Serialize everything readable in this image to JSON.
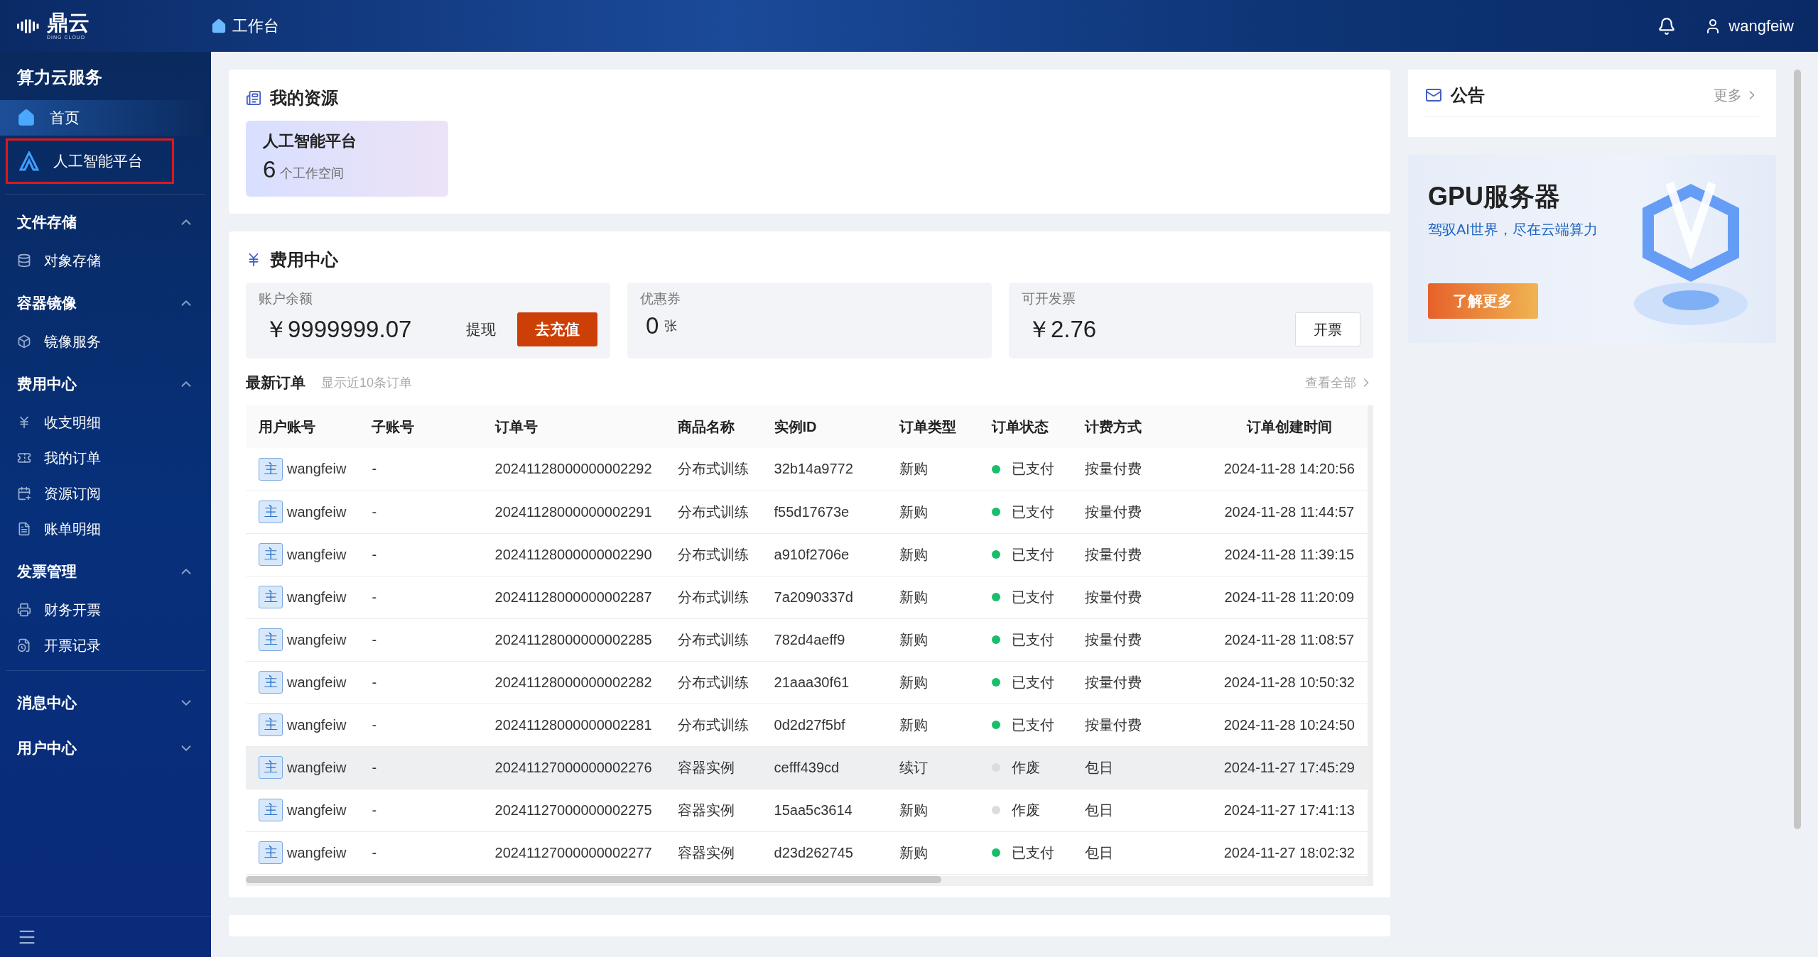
{
  "header": {
    "logo_text": "鼎云",
    "logo_subtext": "DING CLOUD",
    "breadcrumb": "工作台",
    "username": "wangfeiw"
  },
  "sidebar": {
    "title": "算力云服务",
    "top_items": [
      {
        "label": "首页",
        "selected": true,
        "outlined": false
      },
      {
        "label": "人工智能平台",
        "selected": false,
        "outlined": true
      }
    ],
    "sections": [
      {
        "title": "文件存储",
        "expanded": true,
        "items": [
          {
            "label": "对象存储"
          }
        ]
      },
      {
        "title": "容器镜像",
        "expanded": true,
        "items": [
          {
            "label": "镜像服务"
          }
        ]
      },
      {
        "title": "费用中心",
        "expanded": true,
        "items": [
          {
            "label": "收支明细"
          },
          {
            "label": "我的订单"
          },
          {
            "label": "资源订阅"
          },
          {
            "label": "账单明细"
          }
        ]
      },
      {
        "title": "发票管理",
        "expanded": true,
        "items": [
          {
            "label": "财务开票"
          },
          {
            "label": "开票记录"
          }
        ]
      },
      {
        "title": "消息中心",
        "expanded": false
      },
      {
        "title": "用户中心",
        "expanded": false
      }
    ]
  },
  "resources": {
    "title": "我的资源",
    "cards": [
      {
        "name": "人工智能平台",
        "count": "6",
        "unit": "个工作空间"
      }
    ]
  },
  "fees": {
    "title": "费用中心",
    "cards": [
      {
        "kind": "balance",
        "label": "账户余额",
        "value": "￥9999999.07",
        "link": "提现",
        "button": "去充值"
      },
      {
        "kind": "coupon",
        "label": "优惠券",
        "value": "0",
        "unit": "张"
      },
      {
        "kind": "invoice",
        "label": "可开发票",
        "value": "￥2.76",
        "button": "开票"
      }
    ],
    "orders": {
      "title": "最新订单",
      "hint": "显示近10条订单",
      "view_all": "查看全部",
      "columns": [
        "用户账号",
        "子账号",
        "订单号",
        "商品名称",
        "实例ID",
        "订单类型",
        "订单状态",
        "计费方式",
        "订单创建时间"
      ],
      "rows": [
        {
          "badge": "主",
          "user": "wangfeiw",
          "sub": "-",
          "order": "20241128000000002292",
          "product": "分布式训练",
          "instance": "32b14a9772",
          "type": "新购",
          "status": "已支付",
          "color": "#19be6b",
          "billing": "按量付费",
          "created": "2024-11-28 14:20:56",
          "highlighted": false
        },
        {
          "badge": "主",
          "user": "wangfeiw",
          "sub": "-",
          "order": "20241128000000002291",
          "product": "分布式训练",
          "instance": "f55d17673e",
          "type": "新购",
          "status": "已支付",
          "color": "#19be6b",
          "billing": "按量付费",
          "created": "2024-11-28 11:44:57",
          "highlighted": false
        },
        {
          "badge": "主",
          "user": "wangfeiw",
          "sub": "-",
          "order": "20241128000000002290",
          "product": "分布式训练",
          "instance": "a910f2706e",
          "type": "新购",
          "status": "已支付",
          "color": "#19be6b",
          "billing": "按量付费",
          "created": "2024-11-28 11:39:15",
          "highlighted": false
        },
        {
          "badge": "主",
          "user": "wangfeiw",
          "sub": "-",
          "order": "20241128000000002287",
          "product": "分布式训练",
          "instance": "7a2090337d",
          "type": "新购",
          "status": "已支付",
          "color": "#19be6b",
          "billing": "按量付费",
          "created": "2024-11-28 11:20:09",
          "highlighted": false
        },
        {
          "badge": "主",
          "user": "wangfeiw",
          "sub": "-",
          "order": "20241128000000002285",
          "product": "分布式训练",
          "instance": "782d4aeff9",
          "type": "新购",
          "status": "已支付",
          "color": "#19be6b",
          "billing": "按量付费",
          "created": "2024-11-28 11:08:57",
          "highlighted": false
        },
        {
          "badge": "主",
          "user": "wangfeiw",
          "sub": "-",
          "order": "20241128000000002282",
          "product": "分布式训练",
          "instance": "21aaa30f61",
          "type": "新购",
          "status": "已支付",
          "color": "#19be6b",
          "billing": "按量付费",
          "created": "2024-11-28 10:50:32",
          "highlighted": false
        },
        {
          "badge": "主",
          "user": "wangfeiw",
          "sub": "-",
          "order": "20241128000000002281",
          "product": "分布式训练",
          "instance": "0d2d27f5bf",
          "type": "新购",
          "status": "已支付",
          "color": "#19be6b",
          "billing": "按量付费",
          "created": "2024-11-28 10:24:50",
          "highlighted": false
        },
        {
          "badge": "主",
          "user": "wangfeiw",
          "sub": "-",
          "order": "20241127000000002276",
          "product": "容器实例",
          "instance": "cefff439cd",
          "type": "续订",
          "status": "作废",
          "color": "#dcdcdc",
          "billing": "包日",
          "created": "2024-11-27 17:45:29",
          "highlighted": true
        },
        {
          "badge": "主",
          "user": "wangfeiw",
          "sub": "-",
          "order": "20241127000000002275",
          "product": "容器实例",
          "instance": "15aa5c3614",
          "type": "新购",
          "status": "作废",
          "color": "#dcdcdc",
          "billing": "包日",
          "created": "2024-11-27 17:41:13",
          "highlighted": false
        },
        {
          "badge": "主",
          "user": "wangfeiw",
          "sub": "-",
          "order": "20241127000000002277",
          "product": "容器实例",
          "instance": "d23d262745",
          "type": "新购",
          "status": "已支付",
          "color": "#19be6b",
          "billing": "包日",
          "created": "2024-11-27 18:02:32",
          "highlighted": false
        }
      ]
    }
  },
  "notices": {
    "title": "公告",
    "more": "更多"
  },
  "banner": {
    "title": "GPU服务器",
    "subtitle": "驾驭AI世界，尽在云端算力",
    "button": "了解更多"
  }
}
